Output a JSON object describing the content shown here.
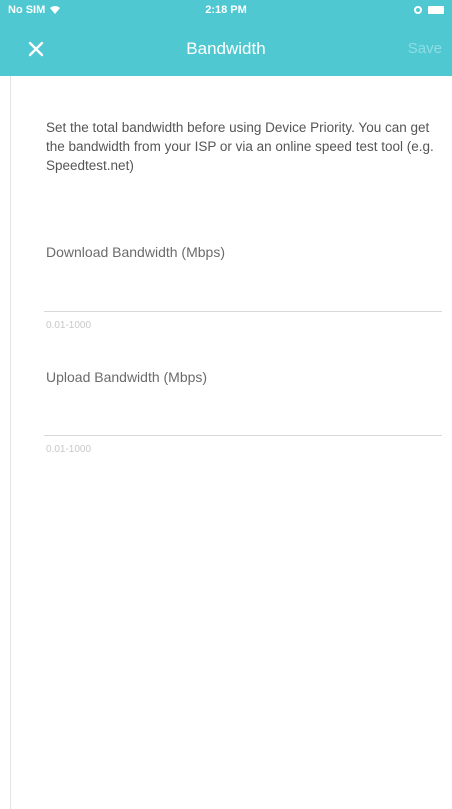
{
  "status_bar": {
    "carrier": "No SIM",
    "time": "2:18 PM"
  },
  "header": {
    "title": "Bandwidth",
    "save_label": "Save"
  },
  "main": {
    "description": "Set the total bandwidth before using Device Priority. You can get the bandwidth from your ISP or via an online speed test tool (e.g. Speedtest.net)",
    "download": {
      "label": "Download Bandwidth (Mbps)",
      "value": "",
      "hint": "0.01-1000"
    },
    "upload": {
      "label": "Upload Bandwidth (Mbps)",
      "value": "",
      "hint": "0.01-1000"
    }
  },
  "colors": {
    "accent": "#4fc8d1"
  },
  "icons": {
    "close": "close-icon",
    "wifi": "wifi-icon",
    "battery": "battery-icon"
  }
}
